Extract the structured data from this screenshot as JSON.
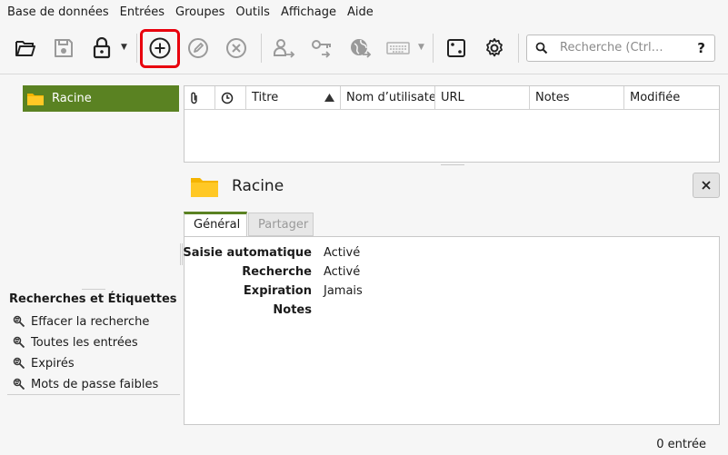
{
  "menu": [
    "Base de données",
    "Entrées",
    "Groupes",
    "Outils",
    "Affichage",
    "Aide"
  ],
  "toolbar": {
    "icons": {
      "open": "folder-open-icon",
      "save": "save-icon",
      "lock": "lock-icon",
      "add_entry": "plus-circle-icon",
      "edit_entry": "pencil-icon",
      "delete_entry": "x-circle-icon",
      "copy_username": "user-arrow-icon",
      "copy_password": "key-arrow-icon",
      "copy_url": "globe-arrow-icon",
      "autotype": "keyboard-icon",
      "generator": "dice-icon",
      "settings": "gear-icon"
    },
    "search_placeholder": "Recherche (Ctrl…",
    "search_help": "?"
  },
  "colors": {
    "accent": "#5a8222",
    "highlight": "#e8000d",
    "folder": "#f5b400"
  },
  "groups": {
    "root_label": "Racine"
  },
  "searches": {
    "title": "Recherches et Étiquettes",
    "items": [
      "Effacer la recherche",
      "Toutes les entrées",
      "Expirés",
      "Mots de passe faibles"
    ]
  },
  "table": {
    "columns": [
      "Titre",
      "Nom d’utilisate",
      "URL",
      "Notes",
      "Modifiée"
    ]
  },
  "details": {
    "title": "Racine",
    "tabs": [
      "Général",
      "Partager"
    ],
    "fields": [
      {
        "label": "Saisie automatique",
        "value": "Activé"
      },
      {
        "label": "Recherche",
        "value": "Activé"
      },
      {
        "label": "Expiration",
        "value": "Jamais"
      },
      {
        "label": "Notes",
        "value": ""
      }
    ]
  },
  "status": "0 entrée"
}
